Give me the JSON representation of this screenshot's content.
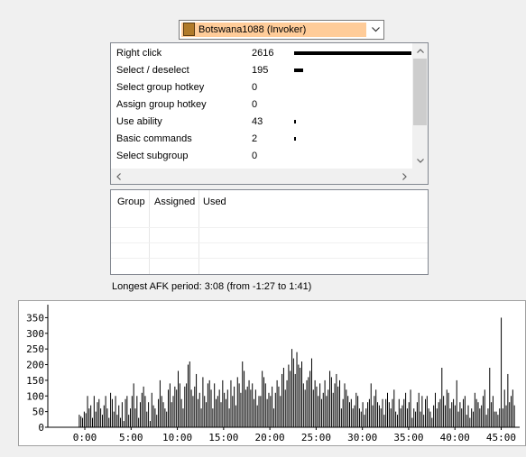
{
  "player_select": {
    "selected": "Botswana1088 (Invoker)",
    "highlight_color": "#ffcc99"
  },
  "hotkey_list": {
    "rows": [
      {
        "label": "Right click",
        "value": "2616",
        "bar": 2616
      },
      {
        "label": "Select / deselect",
        "value": "195",
        "bar": 195
      },
      {
        "label": "Select group hotkey",
        "value": "0",
        "bar": 0
      },
      {
        "label": "Assign group hotkey",
        "value": "0",
        "bar": 0
      },
      {
        "label": "Use ability",
        "value": "43",
        "bar": 43
      },
      {
        "label": "Basic commands",
        "value": "2",
        "bar": 2
      },
      {
        "label": "Select subgroup",
        "value": "0",
        "bar": 0
      }
    ],
    "bar_max": 2616
  },
  "group_table": {
    "headers": [
      "Group",
      "Assigned",
      "Used"
    ]
  },
  "afk_text": "Longest AFK period: 3:08 (from -1:27 to 1:41)",
  "chart_data": {
    "type": "bar",
    "title": "",
    "xlabel": "",
    "ylabel": "",
    "ylim": [
      0,
      380
    ],
    "xlim": [
      -4,
      47
    ],
    "y_ticks": [
      "0",
      "50",
      "100",
      "150",
      "200",
      "250",
      "300",
      "350"
    ],
    "x_ticks": [
      "0:00",
      "5:00",
      "10:00",
      "15:00",
      "20:00",
      "25:00",
      "30:00",
      "35:00",
      "40:00",
      "45:00"
    ],
    "values": [
      0,
      0,
      0,
      0,
      0,
      0,
      0,
      0,
      0,
      0,
      0,
      0,
      0,
      0,
      0,
      0,
      0,
      0,
      40,
      35,
      30,
      50,
      45,
      100,
      60,
      70,
      30,
      100,
      50,
      80,
      90,
      60,
      40,
      70,
      100,
      60,
      30,
      110,
      90,
      50,
      100,
      40,
      70,
      30,
      80,
      20,
      90,
      100,
      40,
      60,
      100,
      140,
      60,
      100,
      30,
      80,
      110,
      130,
      100,
      50,
      80,
      20,
      110,
      70,
      60,
      40,
      90,
      150,
      100,
      80,
      60,
      50,
      120,
      140,
      80,
      100,
      130,
      120,
      180,
      140,
      90,
      60,
      130,
      140,
      200,
      210,
      120,
      100,
      130,
      170,
      90,
      110,
      60,
      160,
      100,
      80,
      140,
      150,
      120,
      60,
      140,
      90,
      100,
      120,
      80,
      150,
      110,
      90,
      120,
      60,
      150,
      100,
      130,
      70,
      160,
      140,
      110,
      210,
      180,
      120,
      130,
      150,
      120,
      140,
      90,
      120,
      70,
      100,
      100,
      180,
      160,
      140,
      90,
      110,
      100,
      130,
      60,
      110,
      150,
      130,
      100,
      170,
      190,
      120,
      150,
      200,
      180,
      250,
      220,
      170,
      240,
      200,
      190,
      210,
      140,
      120,
      150,
      160,
      180,
      220,
      120,
      150,
      130,
      100,
      140,
      90,
      110,
      150,
      100,
      120,
      180,
      160,
      110,
      140,
      170,
      130,
      150,
      60,
      90,
      140,
      120,
      100,
      80,
      90,
      60,
      70,
      110,
      100,
      60,
      50,
      80,
      40,
      60,
      80,
      90,
      140,
      70,
      100,
      120,
      80,
      70,
      60,
      90,
      40,
      90,
      110,
      80,
      60,
      90,
      120,
      50,
      40,
      90,
      60,
      70,
      90,
      110,
      60,
      80,
      120,
      30,
      60,
      50,
      80,
      110,
      50,
      100,
      40,
      90,
      100,
      60,
      50,
      30,
      70,
      110,
      60,
      80,
      90,
      190,
      100,
      70,
      120,
      110,
      60,
      80,
      90,
      70,
      150,
      50,
      80,
      60,
      90,
      100,
      40,
      70,
      30,
      60,
      50,
      110,
      90,
      80,
      60,
      70,
      100,
      120,
      40,
      60,
      190,
      80,
      100,
      50,
      50,
      40,
      60,
      350,
      60,
      120,
      70,
      170,
      80,
      100,
      120,
      70
    ]
  }
}
